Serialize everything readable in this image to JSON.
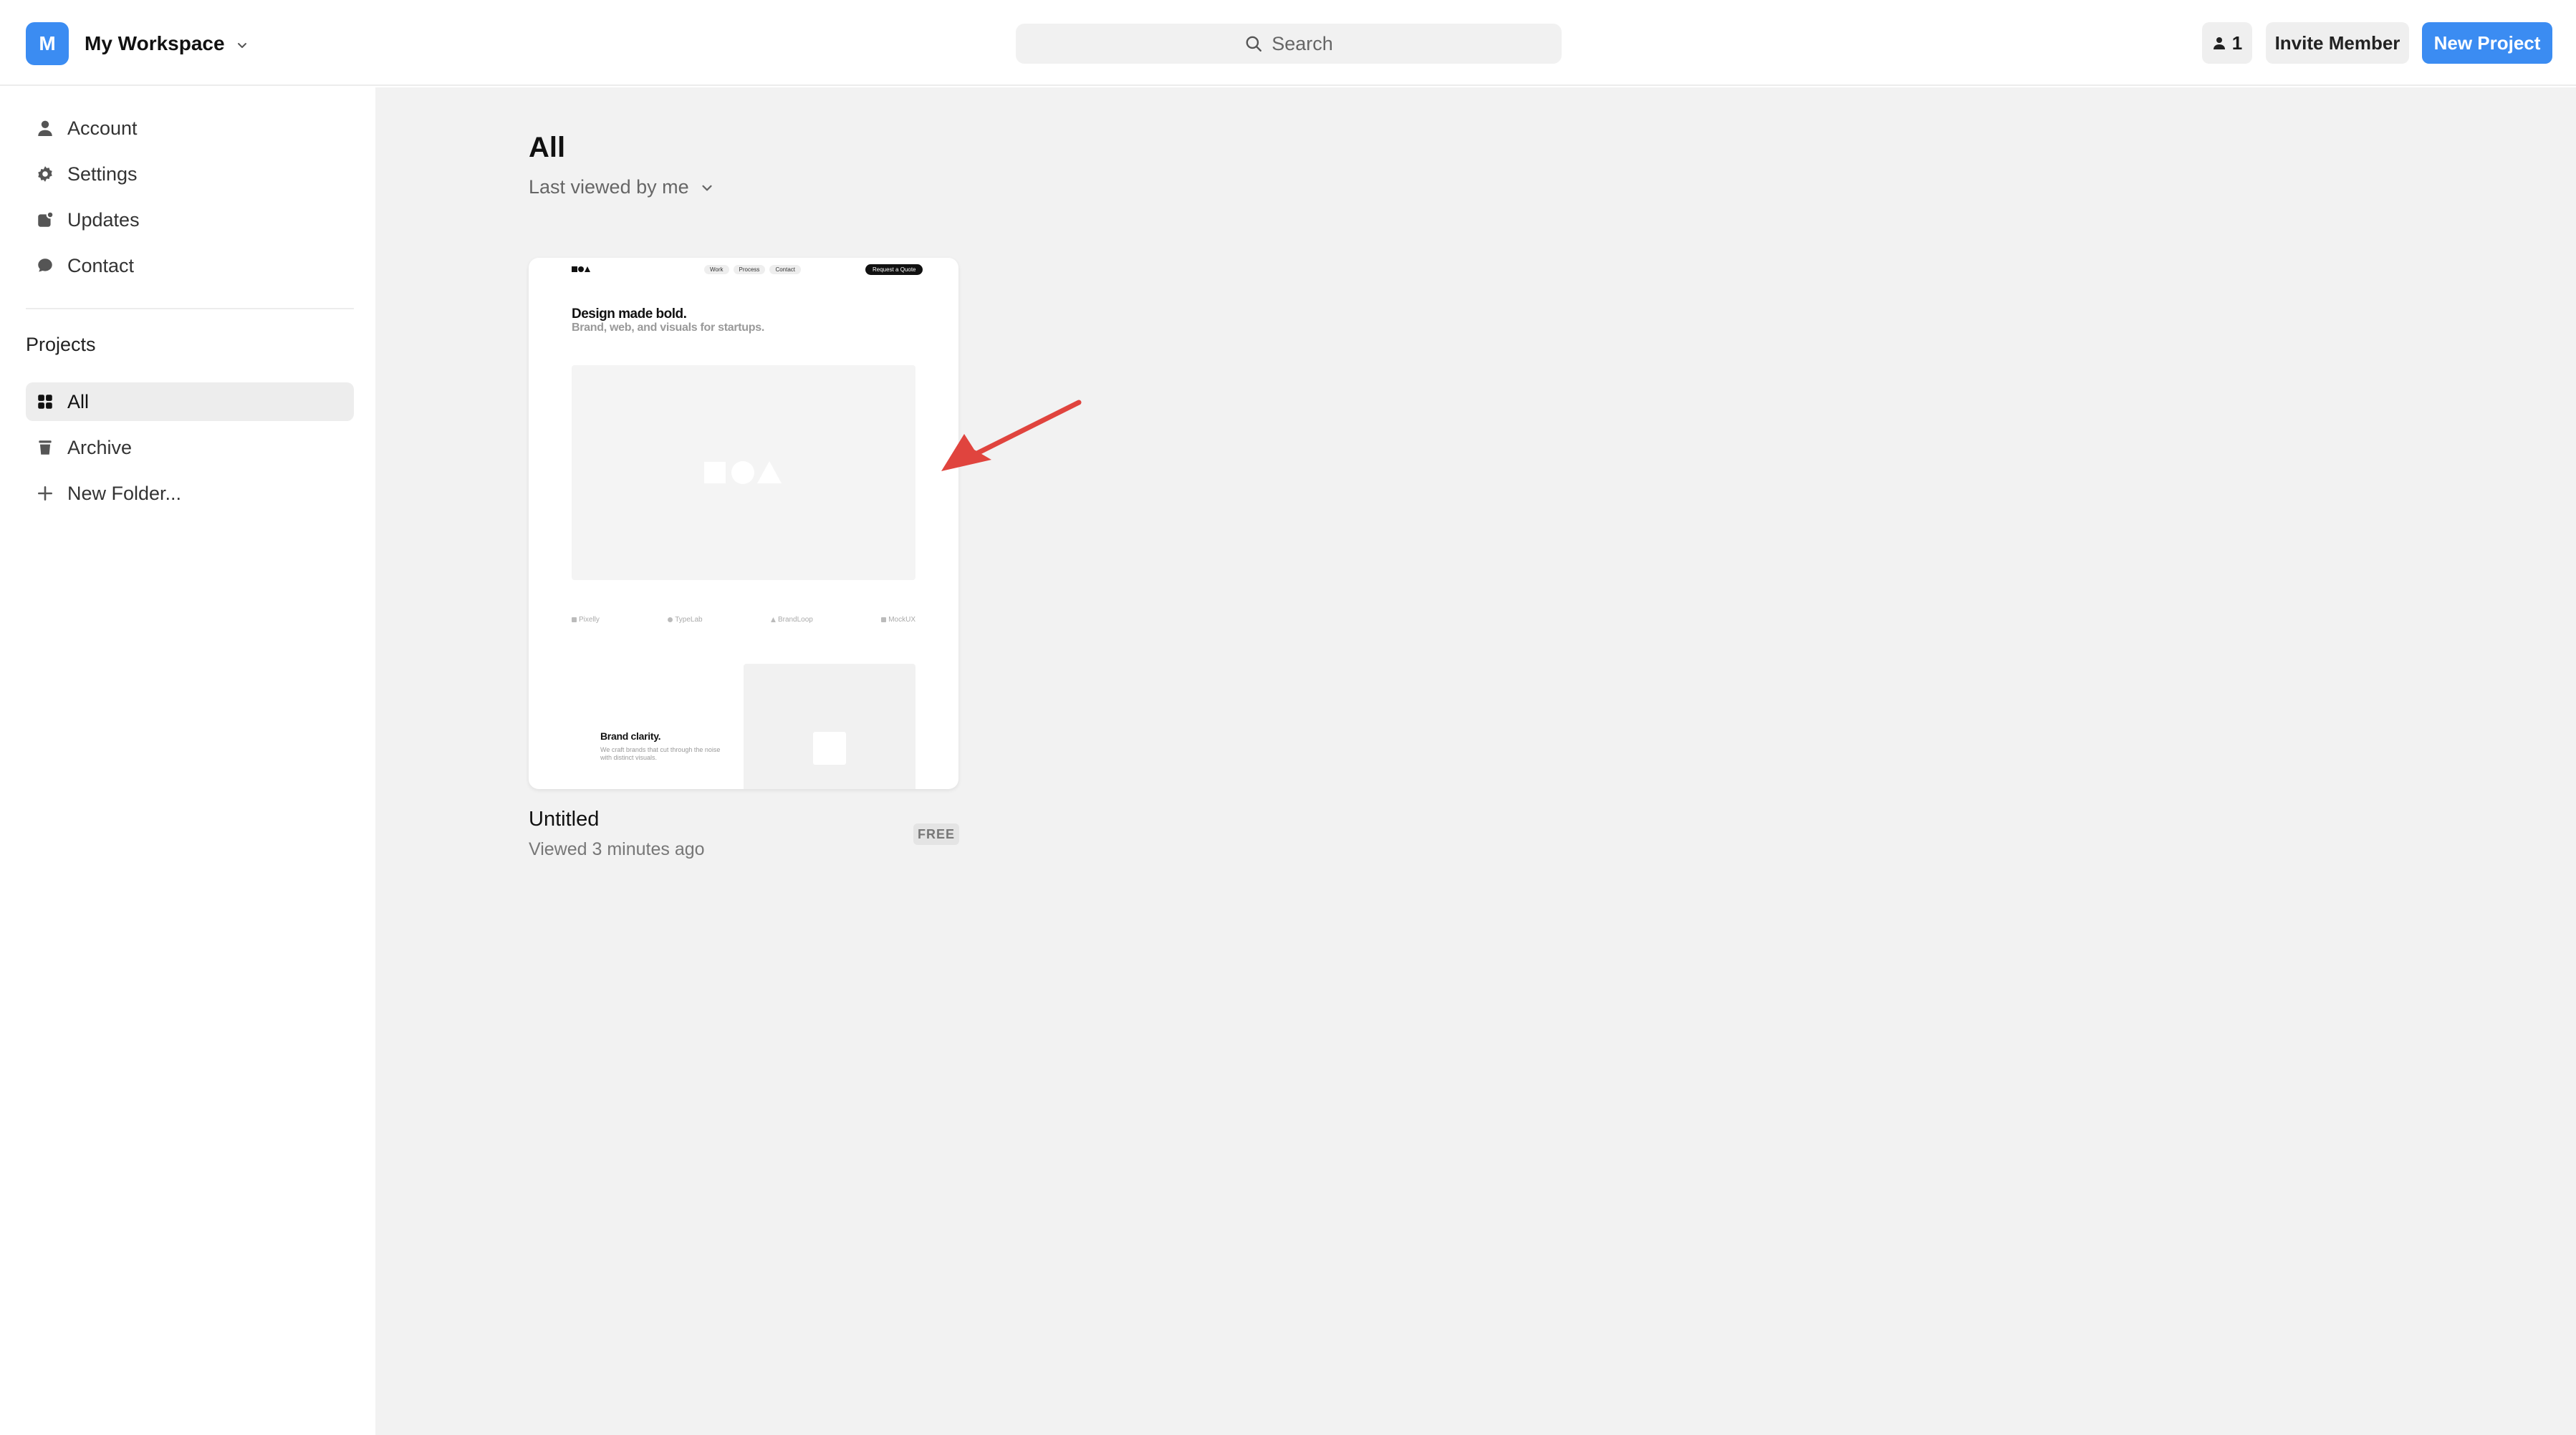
{
  "workspace": {
    "initial": "M",
    "name": "My Workspace"
  },
  "search": {
    "label": "Search"
  },
  "header": {
    "member_count": "1",
    "invite_label": "Invite Member",
    "new_project_label": "New Project"
  },
  "sidebar": {
    "items": [
      {
        "label": "Account",
        "icon": "user-icon"
      },
      {
        "label": "Settings",
        "icon": "gear-icon"
      },
      {
        "label": "Updates",
        "icon": "updates-icon"
      },
      {
        "label": "Contact",
        "icon": "chat-icon"
      }
    ],
    "projects_title": "Projects",
    "project_items": [
      {
        "label": "All",
        "icon": "grid-icon",
        "active": true
      },
      {
        "label": "Archive",
        "icon": "trash-icon"
      },
      {
        "label": "New Folder...",
        "icon": "plus-icon"
      }
    ]
  },
  "main": {
    "title": "All",
    "sort_label": "Last viewed by me",
    "cards": [
      {
        "title": "Untitled",
        "meta": "Viewed 3 minutes ago",
        "badge": "FREE",
        "thumbnail": {
          "nav": [
            "Work",
            "Process",
            "Contact"
          ],
          "cta": "Request a Quote",
          "headline": "Design made bold.",
          "subheadline": "Brand, web, and visuals for startups.",
          "logos": [
            "Pixelly",
            "TypeLab",
            "BrandLoop",
            "MockUX"
          ],
          "section_title": "Brand clarity.",
          "section_text": "We craft brands that cut through the noise with distinct visuals."
        }
      }
    ]
  },
  "colors": {
    "accent": "#3b8cf2",
    "annotation_arrow": "#e0443e"
  }
}
